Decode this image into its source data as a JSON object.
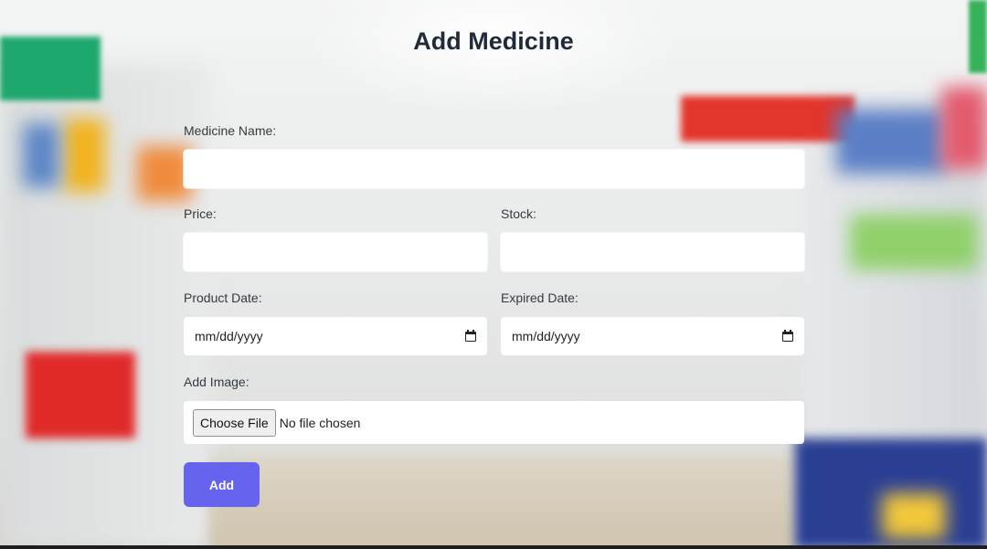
{
  "page": {
    "title": "Add Medicine"
  },
  "form": {
    "medicine_name": {
      "label": "Medicine Name:",
      "value": ""
    },
    "price": {
      "label": "Price:",
      "value": ""
    },
    "stock": {
      "label": "Stock:",
      "value": ""
    },
    "product_date": {
      "label": "Product Date:",
      "value": "mm/dd/yyyy"
    },
    "expired_date": {
      "label": "Expired Date:",
      "value": "mm/dd/yyyy"
    },
    "image": {
      "label": "Add Image:",
      "button_label": "Choose File",
      "status": "No file chosen"
    },
    "submit_label": "Add"
  },
  "icons": {
    "date_picker": "calendar-icon"
  },
  "colors": {
    "submit_button": "#6664ee",
    "title_text": "#1f2a3a",
    "input_background": "#ffffff"
  }
}
